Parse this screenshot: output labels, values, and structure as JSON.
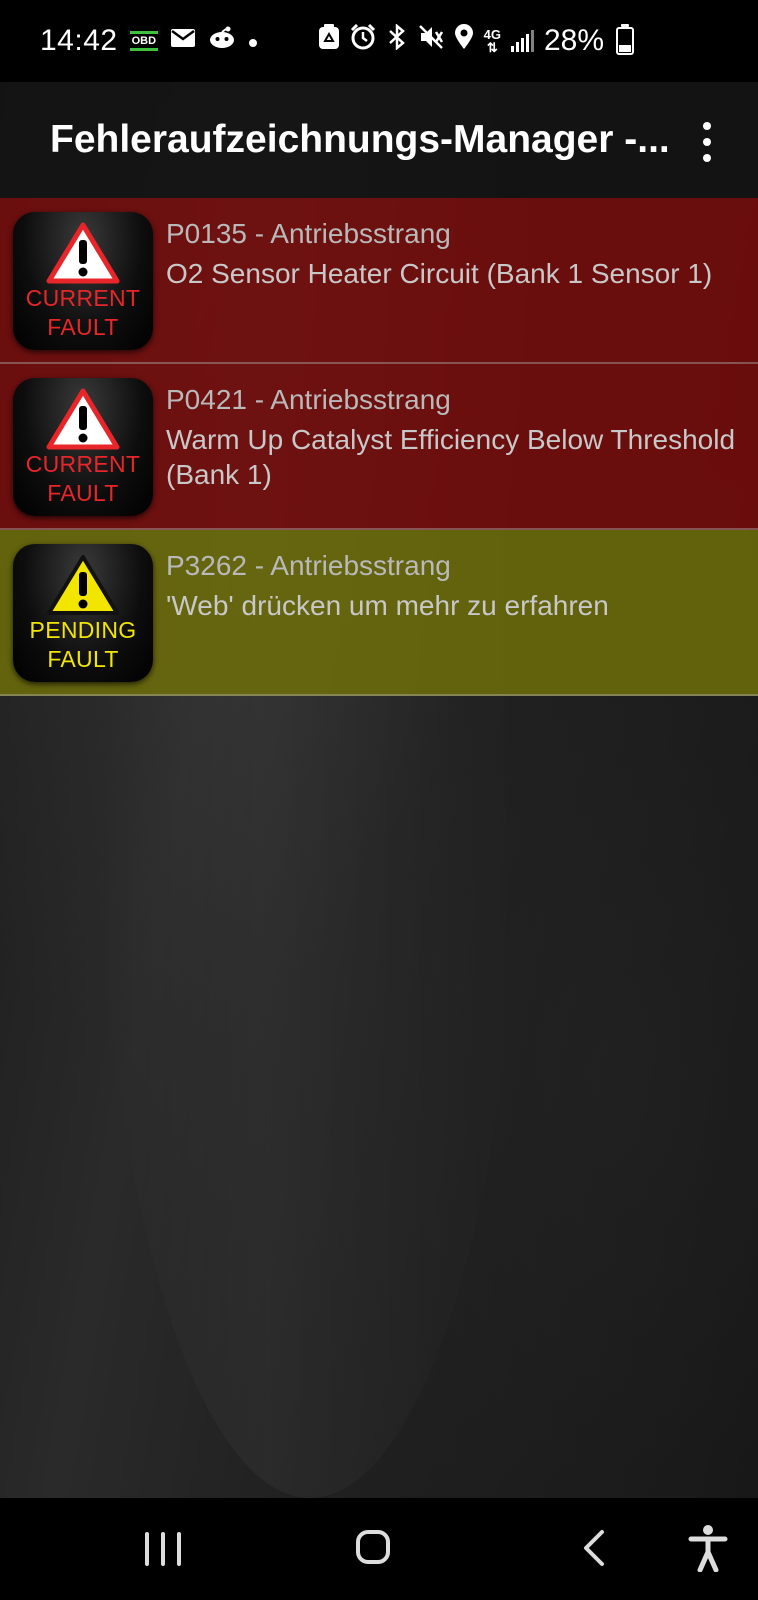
{
  "status_bar": {
    "time": "14:42",
    "obd_label": "OBD",
    "battery_percent": "28%",
    "left_icons": [
      "obd-icon",
      "mail-icon",
      "reddit-icon",
      "dot-icon"
    ],
    "right_icons": [
      "recycle-icon",
      "alarm-icon",
      "bluetooth-icon",
      "mute-vibrate-icon",
      "location-icon",
      "network-4g-icon",
      "signal-icon",
      "battery-icon"
    ],
    "network_label": "4G"
  },
  "app_bar": {
    "title": "Fehleraufzeichnungs-Manager -..."
  },
  "faults": [
    {
      "status": "current",
      "badge_line1": "CURRENT",
      "badge_line2": "FAULT",
      "code": "P0135 - Antriebsstrang",
      "description": "O2 Sensor Heater Circuit (Bank 1 Sensor 1)"
    },
    {
      "status": "current",
      "badge_line1": "CURRENT",
      "badge_line2": "FAULT",
      "code": "P0421 - Antriebsstrang",
      "description": "Warm Up Catalyst Efficiency Below Threshold (Bank 1)"
    },
    {
      "status": "pending",
      "badge_line1": "PENDING",
      "badge_line2": "FAULT",
      "code": "P3262 - Antriebsstrang",
      "description": "'Web' drücken um mehr zu erfahren"
    }
  ],
  "colors": {
    "current_row": "#780a0a",
    "pending_row": "#6e6e0a",
    "current_badge_text": "#e8262a",
    "pending_badge_text": "#f2e600"
  },
  "nav_bar": {
    "icons": [
      "recents-icon",
      "home-icon",
      "back-icon",
      "accessibility-icon"
    ]
  }
}
